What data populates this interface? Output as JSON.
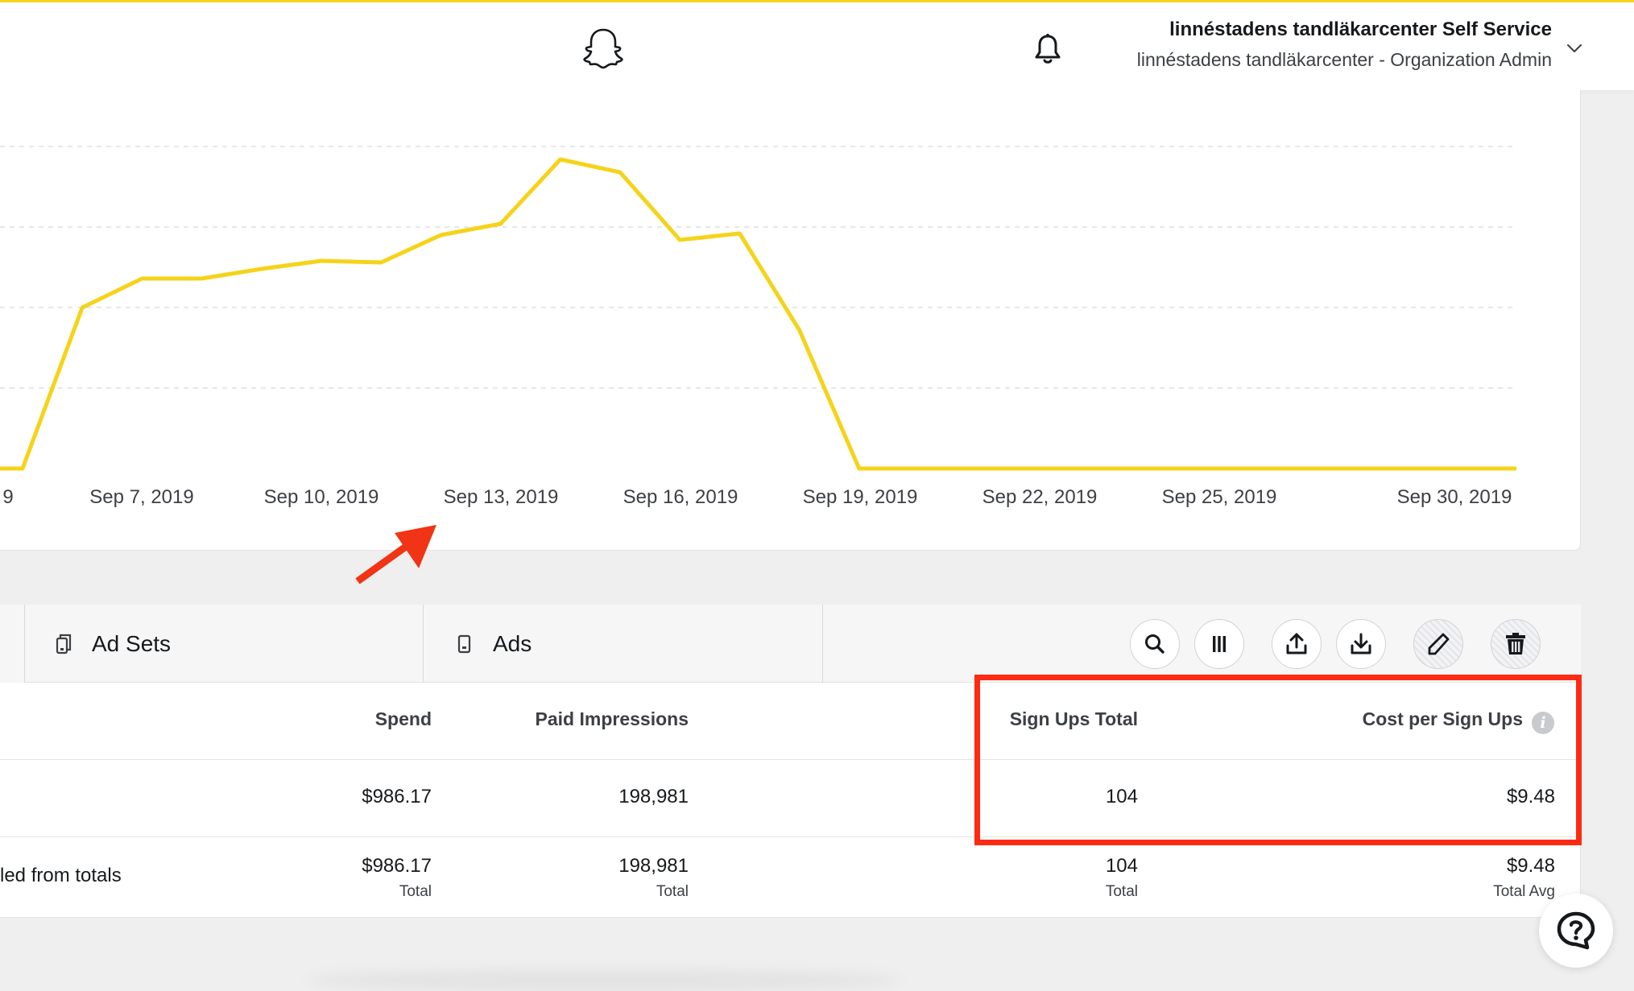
{
  "header": {
    "account_name": "linnéstadens tandläkarcenter Self Service",
    "account_role": "linnéstadens tandläkarcenter - Organization Admin"
  },
  "colors": {
    "accent": "#f5d31a",
    "highlight_box": "#ff2a12",
    "arrow": "#f03415"
  },
  "icons": [
    "snapchat-ghost-icon",
    "bell-icon",
    "chevron-down-icon",
    "ad-sets-icon",
    "ads-icon",
    "search-icon",
    "columns-icon",
    "upload-icon",
    "download-icon",
    "pencil-icon",
    "trash-icon",
    "info-icon",
    "help-icon"
  ],
  "chart_data": {
    "type": "line",
    "x_tick_labels": [
      "9",
      "Sep 7, 2019",
      "Sep 10, 2019",
      "Sep 13, 2019",
      "Sep 16, 2019",
      "Sep 19, 2019",
      "Sep 22, 2019",
      "Sep 25, 2019",
      "Sep 30, 2019"
    ],
    "x": [
      "Sep 5, 2019",
      "Sep 6, 2019",
      "Sep 7, 2019",
      "Sep 8, 2019",
      "Sep 9, 2019",
      "Sep 10, 2019",
      "Sep 11, 2019",
      "Sep 12, 2019",
      "Sep 13, 2019",
      "Sep 14, 2019",
      "Sep 15, 2019",
      "Sep 16, 2019",
      "Sep 17, 2019",
      "Sep 18, 2019",
      "Sep 19, 2019",
      "Sep 20, 2019",
      "Sep 21, 2019",
      "Sep 22, 2019",
      "Sep 23, 2019",
      "Sep 24, 2019",
      "Sep 25, 2019",
      "Sep 26, 2019",
      "Sep 27, 2019",
      "Sep 28, 2019",
      "Sep 29, 2019",
      "Sep 30, 2019"
    ],
    "values": [
      0,
      50,
      59,
      59,
      62,
      64.5,
      64,
      72.5,
      76,
      96,
      92,
      71,
      73,
      43,
      0,
      0,
      0,
      0,
      0,
      0,
      0,
      0,
      0,
      0,
      0,
      0
    ],
    "ylim": [
      0,
      100
    ],
    "grid": true,
    "line_color": "#f5d31a"
  },
  "tabs": [
    {
      "label": "Ad Sets"
    },
    {
      "label": "Ads"
    }
  ],
  "table": {
    "headers": {
      "spend": "Spend",
      "paid_impressions": "Paid Impressions",
      "sign_ups_total": "Sign Ups Total",
      "cost_per_sign_ups": "Cost per Sign Ups"
    },
    "row": {
      "spend": "$986.17",
      "paid_impressions": "198,981",
      "sign_ups_total": "104",
      "cost_per_sign_ups": "$9.48"
    },
    "totals": {
      "label": "led from totals",
      "spend": "$986.17",
      "spend_sub": "Total",
      "paid_impressions": "198,981",
      "paid_impressions_sub": "Total",
      "sign_ups_total": "104",
      "sign_ups_total_sub": "Total",
      "cost_per_sign_ups": "$9.48",
      "cost_per_sign_ups_sub": "Total Avg"
    }
  }
}
